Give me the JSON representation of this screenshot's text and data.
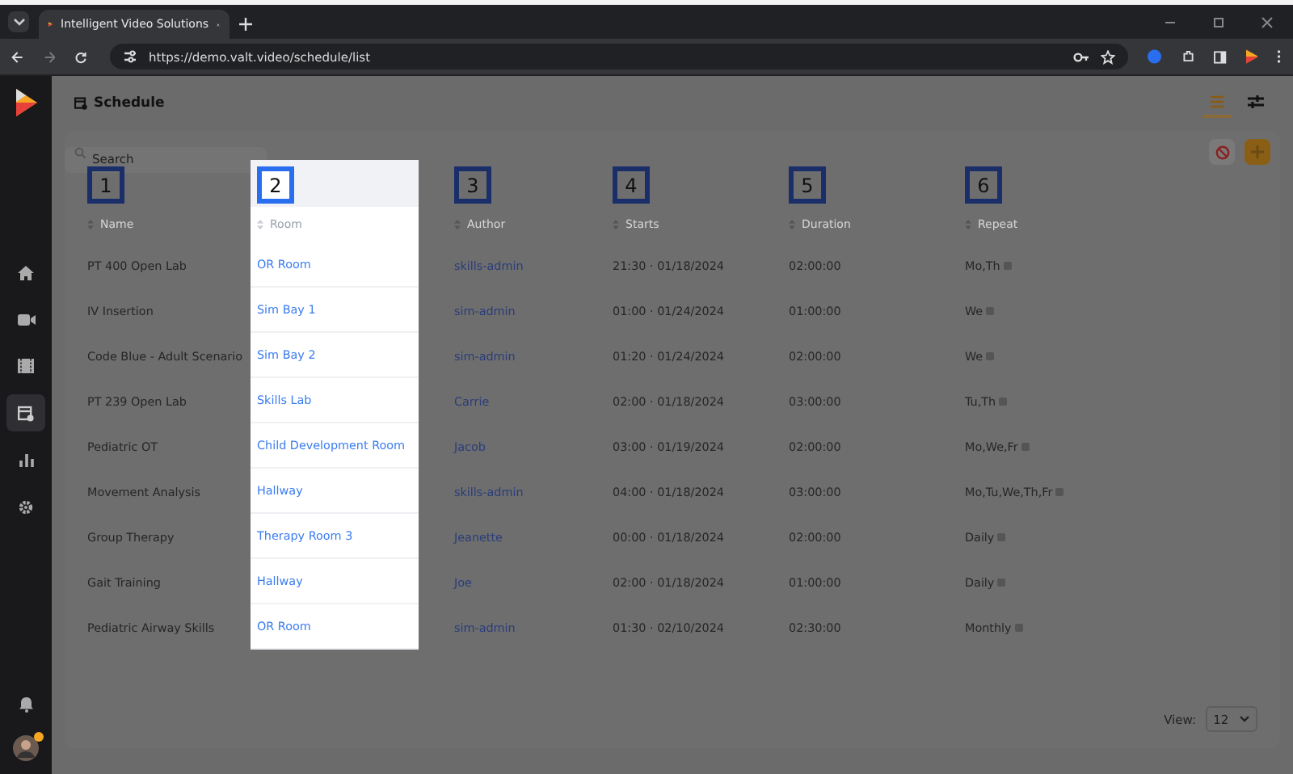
{
  "browser": {
    "tab_title": "Intelligent Video Solutions",
    "url": "https://demo.valt.video/schedule/list"
  },
  "sidebar": {
    "items": [
      {
        "kind": "home",
        "selected": false
      },
      {
        "kind": "camera",
        "selected": false
      },
      {
        "kind": "film",
        "selected": false
      },
      {
        "kind": "schedule",
        "selected": true
      },
      {
        "kind": "chart",
        "selected": false
      },
      {
        "kind": "settings",
        "selected": false
      }
    ],
    "avatar": {
      "notification": true
    }
  },
  "page": {
    "title": "Schedule",
    "view_modes": [
      {
        "kind": "list",
        "selected": true
      },
      {
        "kind": "sliders",
        "selected": false
      }
    ]
  },
  "search": {
    "placeholder": "Search"
  },
  "columns": [
    {
      "label": "Name",
      "marker": "1",
      "highlighted": false,
      "kind": "text"
    },
    {
      "label": "Room",
      "marker": "2",
      "highlighted": true,
      "kind": "link"
    },
    {
      "label": "Author",
      "marker": "3",
      "highlighted": false,
      "kind": "link"
    },
    {
      "label": "Starts",
      "marker": "4",
      "highlighted": false,
      "kind": "text"
    },
    {
      "label": "Duration",
      "marker": "5",
      "highlighted": false,
      "kind": "text"
    },
    {
      "label": "Repeat",
      "marker": "6",
      "highlighted": false,
      "kind": "repeat"
    }
  ],
  "rows": [
    [
      "PT 400 Open Lab",
      "OR Room",
      "skills-admin",
      "21:30 · 01/18/2024",
      "02:00:00",
      "Mo,Th"
    ],
    [
      "IV Insertion",
      "Sim Bay 1",
      "sim-admin",
      "01:00 · 01/24/2024",
      "01:00:00",
      "We"
    ],
    [
      "Code Blue - Adult Scenario",
      "Sim Bay 2",
      "sim-admin",
      "01:20 · 01/24/2024",
      "02:00:00",
      "We"
    ],
    [
      "PT 239 Open Lab",
      "Skills Lab",
      "Carrie",
      "02:00 · 01/18/2024",
      "03:00:00",
      "Tu,Th"
    ],
    [
      "Pediatric OT",
      "Child Development Room",
      "Jacob",
      "03:00 · 01/19/2024",
      "02:00:00",
      "Mo,We,Fr"
    ],
    [
      "Movement Analysis",
      "Hallway",
      "skills-admin",
      "04:00 · 01/18/2024",
      "03:00:00",
      "Mo,Tu,We,Th,Fr"
    ],
    [
      "Group Therapy",
      "Therapy Room 3",
      "Jeanette",
      "00:00 · 01/18/2024",
      "02:00:00",
      "Daily"
    ],
    [
      "Gait Training",
      "Hallway",
      "Joe",
      "02:00 · 01/18/2024",
      "01:00:00",
      "Daily"
    ],
    [
      "Pediatric Airway Skills",
      "OR Room",
      "sim-admin",
      "01:30 · 02/10/2024",
      "02:30:00",
      "Monthly"
    ]
  ],
  "view": {
    "label": "View:",
    "value": "12"
  }
}
